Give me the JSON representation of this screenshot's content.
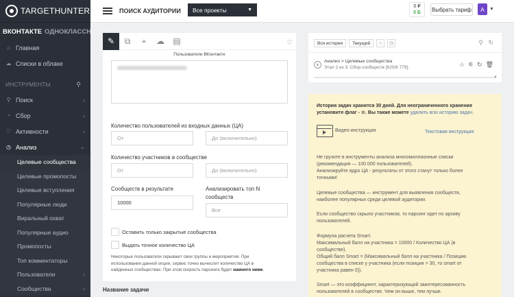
{
  "brand": {
    "logo": "TARGETHUNTER"
  },
  "nets": {
    "vk": "ВКОНТАКТЕ",
    "ok": "ОДНОКЛАССНИКИ"
  },
  "sidebar": {
    "main_items": [
      {
        "label": "Главная",
        "icon": "home-icon"
      },
      {
        "label": "Списки в облаке",
        "icon": "cloud-icon"
      }
    ],
    "tools_header": "ИНСТРУМЕНТЫ",
    "tool_items": [
      {
        "label": "Поиск",
        "icon": "search-icon"
      },
      {
        "label": "Сбор",
        "icon": "collect-icon"
      },
      {
        "label": "Активности",
        "icon": "heart-icon"
      },
      {
        "label": "Анализ",
        "icon": "clock-icon"
      }
    ],
    "sub_items": [
      "Целевые сообщества",
      "Целевые промопосты",
      "Целевые вступления",
      "Популярные люди",
      "Виральный охват",
      "Популярные аудио",
      "Промопосты",
      "Топ комментаторы",
      "Пользователи",
      "Сообщества"
    ]
  },
  "topbar": {
    "title": "ПОИСК АУДИТОРИИ",
    "project": "Все проекты",
    "balance_top": "0 ₽",
    "balance_bottom": "0 Б",
    "tariff_button": "Выбрать тариф",
    "avatar": "A"
  },
  "form": {
    "source_label": "Пользователи ВКонтакте",
    "q1_label": "Количество пользователей из входных данных (ЦА)",
    "q1_from": "От",
    "q1_to": "До (включительно)",
    "q2_label": "Количество участников в сообществе",
    "q2_from": "От",
    "q2_to": "До (включительно)",
    "res_label": "Сообществ в результате",
    "res_value": "10000",
    "top_label_1": "Анализировать топ N",
    "top_label_2": "сообществ",
    "top_placeholder": "Все",
    "chk1": "Оставить только закрытые сообщества",
    "chk2": "Выдать точное количество ЦА",
    "note_1": "Некоторые пользователи скрывают свои группы и мероприятия. При",
    "note_2": "использовании данной опции, сервис точно вычислит количество ЦА в",
    "note_3": "найденных сообществах. При этом скорость парсинга будет",
    "note_bold": "намного ниже",
    "note_end": ".",
    "task_name_label": "Название задачи"
  },
  "history": {
    "tab_all": "Вся история",
    "tab_current": "Текущий",
    "task_title": "Анализ > Целевые сообщества",
    "task_status": "Этап 2 из 3: Сбор сообществ [620/8 779]."
  },
  "info": {
    "h1": "История задач хранится 30 дней. Для неограниченного хранения",
    "h2a": "установите флаг - ☆. Вы также можете ",
    "h2link": "удалить всю историю задач",
    "h2b": ".",
    "video": "Видео-инструкция",
    "text_instr": "Текстовая инструкция",
    "p1": "Не грузите в инструменты анализа многомиллионные списки",
    "p2": "(рекомендация — 100 000 пользователей).",
    "p3": "Анализируйте ядро ЦА - результаты от этого станут только более",
    "p4": "точными!",
    "p5": "Целевые сообщества — инструмент для выявления сообществ,",
    "p6": "наиболее популярных среди целевой аудитории.",
    "p7": "Если сообщество скрыло участников, то парсинг идет по архиву",
    "p8": "пользователей.",
    "p9": "Формула расчета Smart:",
    "p10": "Максимальный балл на участника = 10000 / Количество ЦА (в",
    "p11": "сообществе).",
    "p12": "Общий балл Smart = (Максимальный балл на участника / Позицию",
    "p13": "сообщества в списке у участника (если позиция > 30, то smart от",
    "p14": "участника равен 0)).",
    "p15": "Smart — это коэффициент, характеризующий заинтересованность",
    "p16": "пользователей в сообществе. Чем он выше, тем лучше."
  },
  "colors": {
    "sidebar": "#2b2f38",
    "accent": "#6e45c8",
    "info_bg": "#fcf3d1",
    "link": "#4a76a8"
  }
}
